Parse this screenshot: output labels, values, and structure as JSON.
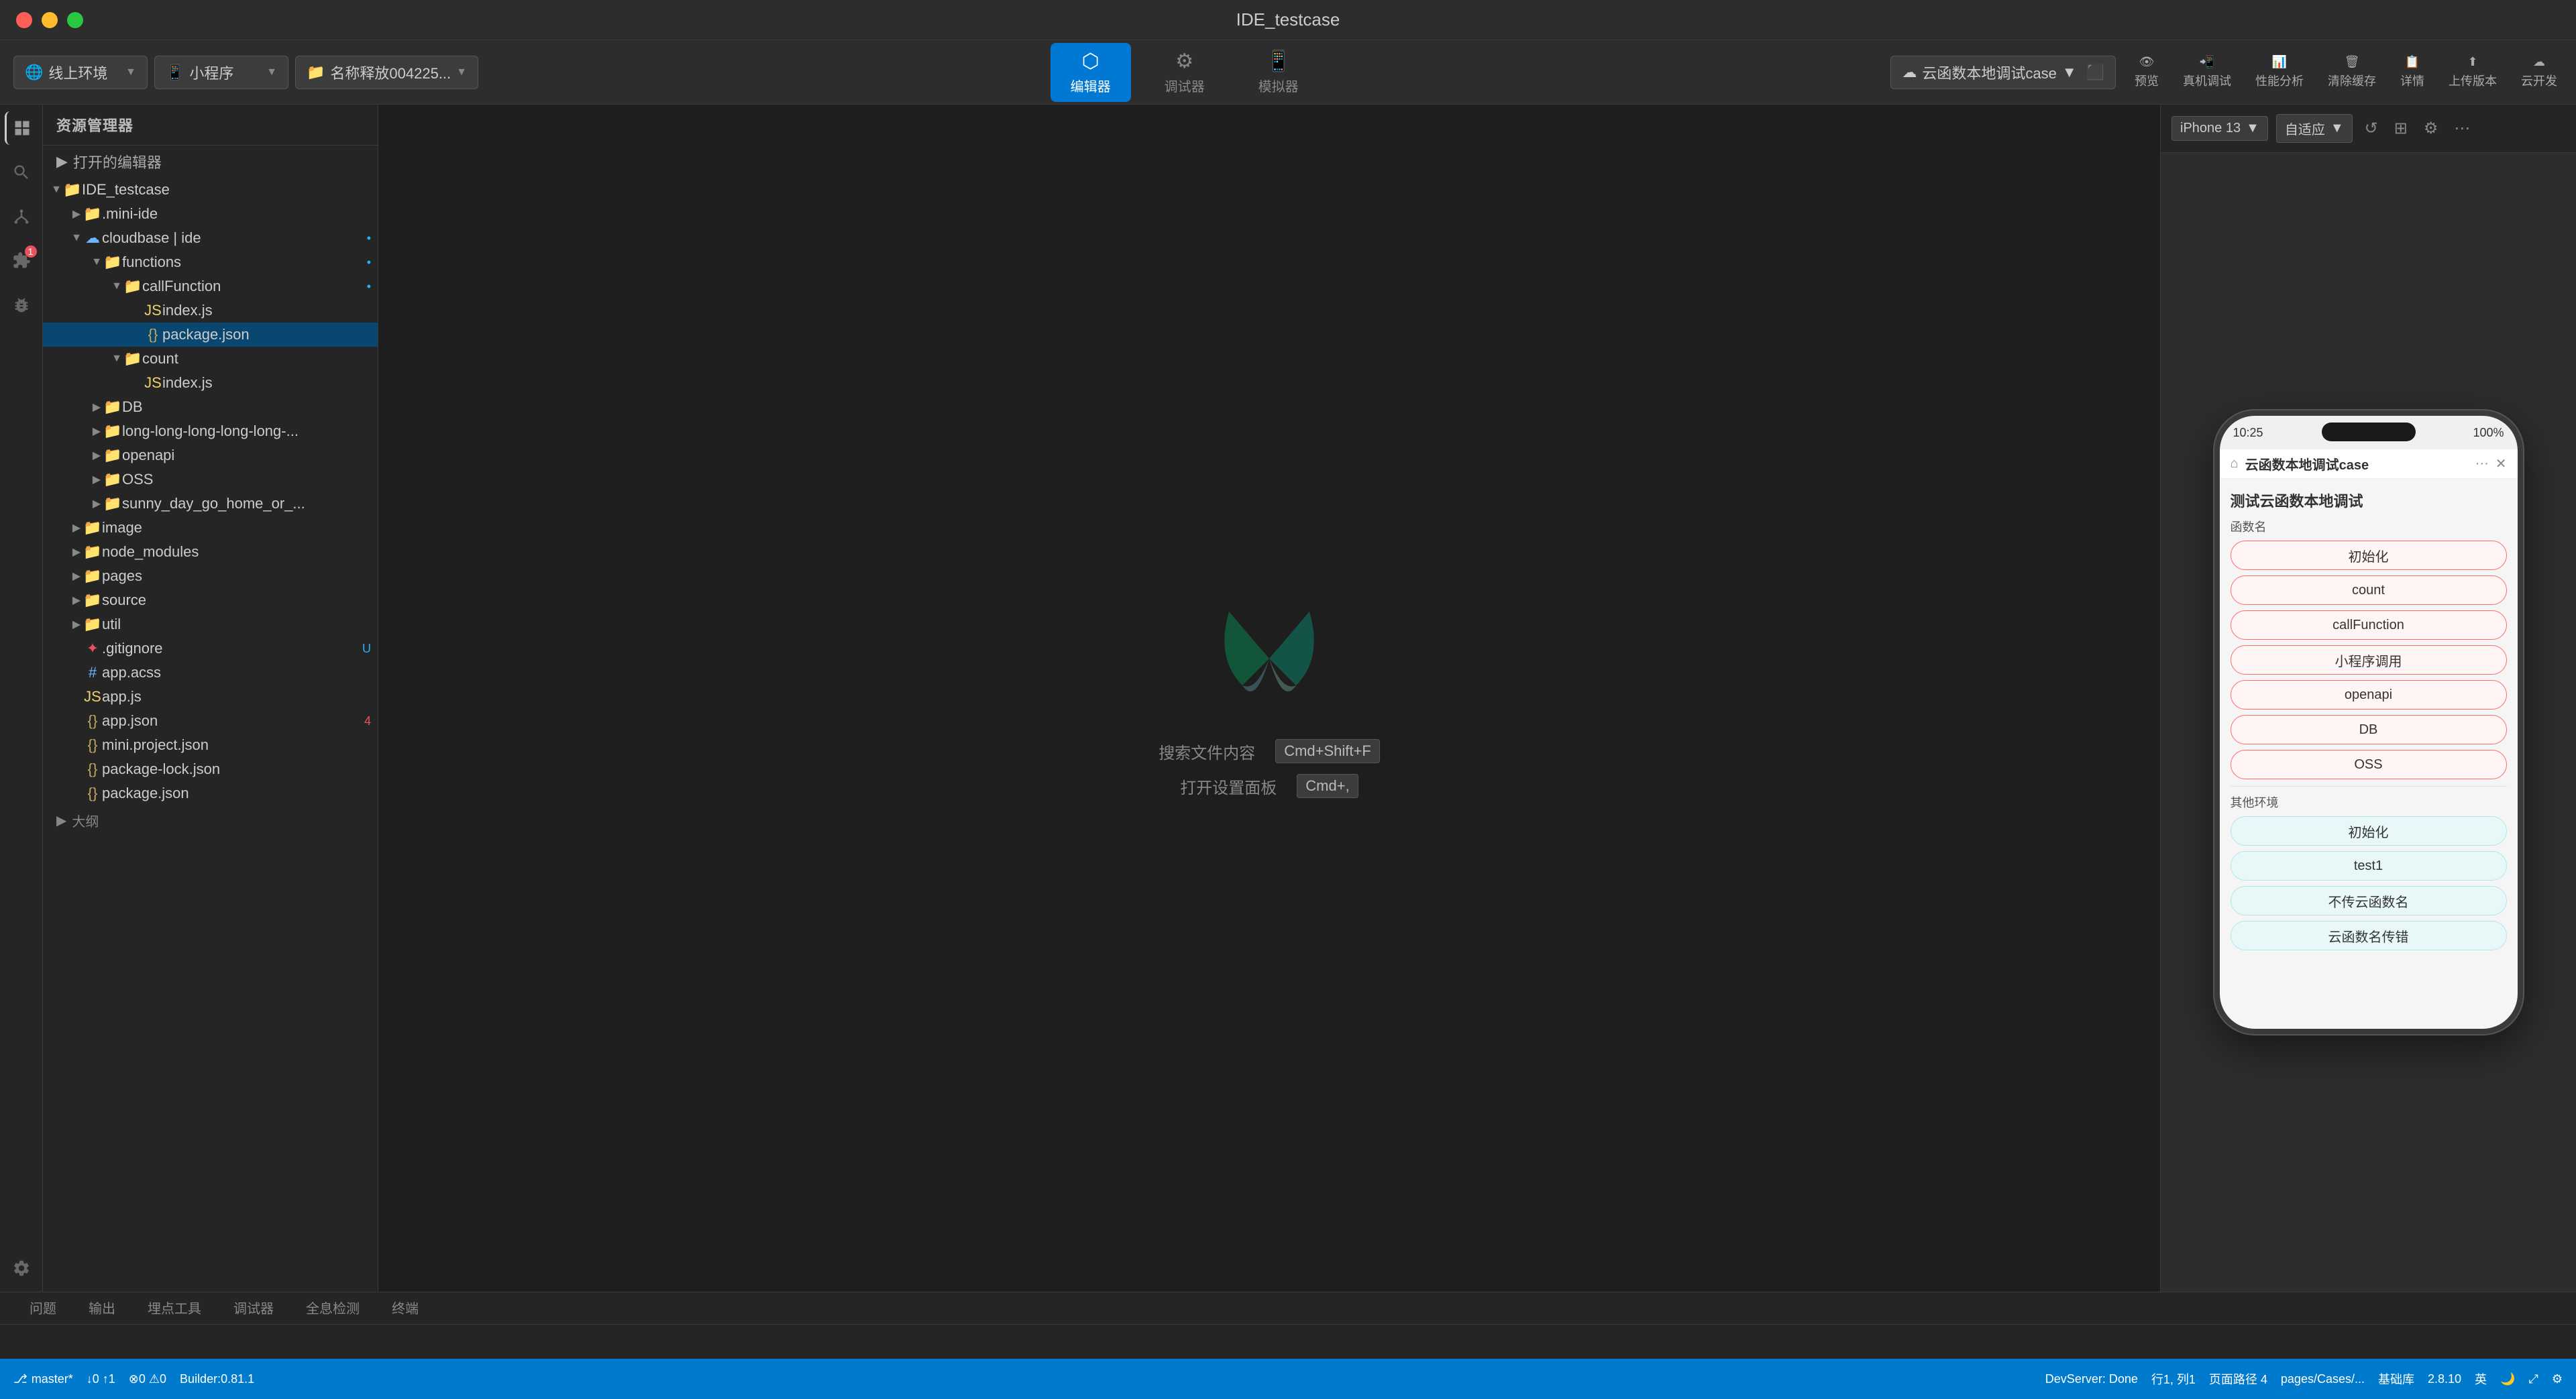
{
  "window": {
    "title": "IDE_testcase"
  },
  "traffic_lights": {
    "red": "close",
    "yellow": "minimize",
    "green": "maximize"
  },
  "toolbar": {
    "env_label": "线上环境",
    "miniprogram_label": "小程序",
    "project_label": "名称释放004225...",
    "editor_label": "编辑器",
    "debugger_label": "调试器",
    "simulator_label": "模拟器",
    "preview_label": "预览",
    "real_debug_label": "真机调试",
    "performance_label": "性能分析",
    "clear_cache_label": "清除缓存",
    "detail_label": "详情",
    "upload_label": "上传版本",
    "cloud_dev_label": "云开发",
    "cloud_test_label": "云函数本地调试case",
    "device_label": "iPhone 13",
    "zoom_label": "自适应"
  },
  "sidebar": {
    "header": "资源管理器",
    "open_editor": "打开的编辑器",
    "project": "IDE_testcase",
    "items": [
      {
        "name": ".mini-ide",
        "type": "folder",
        "indent": 1,
        "expanded": false
      },
      {
        "name": "cloudbase | ide",
        "type": "folder-cloud",
        "indent": 1,
        "expanded": true,
        "badge": "dot"
      },
      {
        "name": "functions",
        "type": "folder",
        "indent": 2,
        "expanded": true,
        "badge": "dot"
      },
      {
        "name": "callFunction",
        "type": "folder",
        "indent": 3,
        "expanded": true,
        "badge": "dot"
      },
      {
        "name": "index.js",
        "type": "js",
        "indent": 4
      },
      {
        "name": "package.json",
        "type": "json",
        "indent": 4,
        "selected": true
      },
      {
        "name": "count",
        "type": "folder",
        "indent": 3,
        "expanded": true
      },
      {
        "name": "index.js",
        "type": "js",
        "indent": 4
      },
      {
        "name": "DB",
        "type": "folder",
        "indent": 2,
        "expanded": false
      },
      {
        "name": "long-long-long-long-long-...",
        "type": "folder",
        "indent": 2,
        "expanded": false
      },
      {
        "name": "openapi",
        "type": "folder",
        "indent": 2,
        "expanded": false
      },
      {
        "name": "OSS",
        "type": "folder",
        "indent": 2,
        "expanded": false
      },
      {
        "name": "sunny_day_go_home_or_...",
        "type": "folder",
        "indent": 2,
        "expanded": false
      },
      {
        "name": "image",
        "type": "folder",
        "indent": 1,
        "expanded": false
      },
      {
        "name": "node_modules",
        "type": "folder",
        "indent": 1,
        "expanded": false
      },
      {
        "name": "pages",
        "type": "folder",
        "indent": 1,
        "expanded": false
      },
      {
        "name": "source",
        "type": "folder",
        "indent": 1,
        "expanded": false
      },
      {
        "name": "util",
        "type": "folder",
        "indent": 1,
        "expanded": false
      },
      {
        "name": ".gitignore",
        "type": "gitignore",
        "indent": 1,
        "badge": "U"
      },
      {
        "name": "app.acss",
        "type": "acss",
        "indent": 1
      },
      {
        "name": "app.js",
        "type": "js",
        "indent": 1
      },
      {
        "name": "app.json",
        "type": "json",
        "indent": 1,
        "badge": "4"
      },
      {
        "name": "mini.project.json",
        "type": "json",
        "indent": 1
      },
      {
        "name": "package-lock.json",
        "type": "json",
        "indent": 1
      },
      {
        "name": "package.json",
        "type": "json",
        "indent": 1
      }
    ],
    "outline": "大纲"
  },
  "editor": {
    "search_label": "搜索文件内容",
    "search_shortcut": "Cmd+Shift+F",
    "settings_label": "打开设置面板",
    "settings_shortcut": "Cmd+,"
  },
  "phone": {
    "time": "10:25",
    "battery": "100%",
    "app_name": "云函数本地调试case",
    "page_title": "测试云函数本地调试",
    "functions_label": "函数名",
    "buttons_main": [
      "初始化",
      "count",
      "callFunction",
      "小程序调用",
      "openapi",
      "DB",
      "OSS"
    ],
    "other_env_label": "其他环境",
    "buttons_other": [
      "初始化",
      "test1",
      "不传云函数名",
      "云函数名传错"
    ]
  },
  "bottom_tabs": [
    {
      "label": "问题",
      "active": false
    },
    {
      "label": "输出",
      "active": false
    },
    {
      "label": "埋点工具",
      "active": false
    },
    {
      "label": "调试器",
      "active": false
    },
    {
      "label": "全息检测",
      "active": false
    },
    {
      "label": "终端",
      "active": false
    }
  ],
  "status_bar": {
    "branch": "master*",
    "sync": "↓0 ↑1",
    "errors": "⊗0 ⚠0",
    "builder": "Builder:0.81.1",
    "dev_server": "DevServer: Done",
    "cursor": "行1, 列1",
    "page_path": "页面路径  4",
    "path": "pages/Cases/...",
    "base_lib": "基础库",
    "version": "2.8.10",
    "lang_en": "英"
  }
}
